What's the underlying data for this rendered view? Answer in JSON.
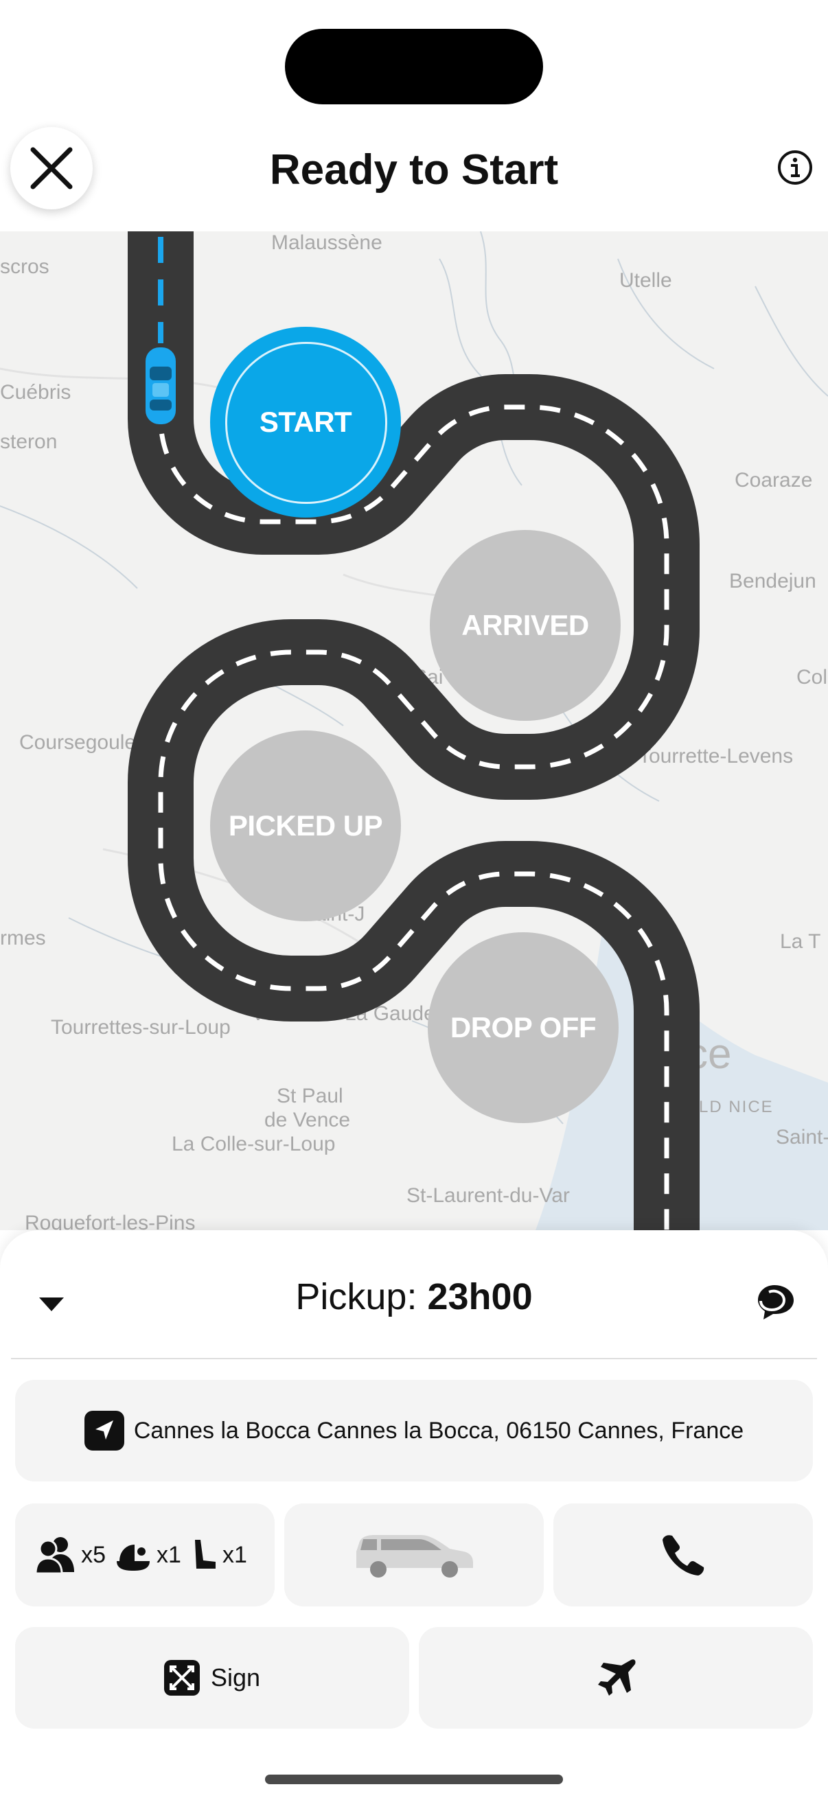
{
  "header": {
    "title": "Ready to Start"
  },
  "map": {
    "places": [
      "Malaussène",
      "Utelle",
      "scros",
      "Cuébris",
      "steron",
      "Coaraze",
      "Bendejun",
      "Coursegoule",
      "Tourrette-Levens",
      "rmes",
      "Tourrettes-sur-Loup",
      "Vence",
      "La Gaude",
      "St Paul",
      "de Vence",
      "La Colle-sur-Loup",
      "St-Laurent-du-Var",
      "Roquefort-les-Pins",
      "Saint-J",
      "LD NICE",
      "Saint-",
      "La T",
      "Col",
      "ce",
      "Sai"
    ]
  },
  "stages": [
    "START",
    "ARRIVED",
    "PICKED UP",
    "DROP OFF"
  ],
  "sheet": {
    "pickup_label": "Pickup:",
    "pickup_time": "23h00",
    "address": "Cannes la Bocca Cannes la Bocca, 06150 Cannes, France",
    "passengers": "x5",
    "baby_seats": "x1",
    "booster_seats": "x1",
    "sign_label": "Sign"
  },
  "colors": {
    "accent": "#0aa7e8",
    "road": "#383838",
    "inactive": "#c4c4c4"
  },
  "icons": [
    "close-icon",
    "info-icon",
    "car-icon",
    "chevron-down-icon",
    "chat-icon",
    "navigation-arrow-icon",
    "passengers-icon",
    "baby-seat-icon",
    "booster-seat-icon",
    "van-icon",
    "phone-icon",
    "sign-icon",
    "airplane-icon"
  ]
}
